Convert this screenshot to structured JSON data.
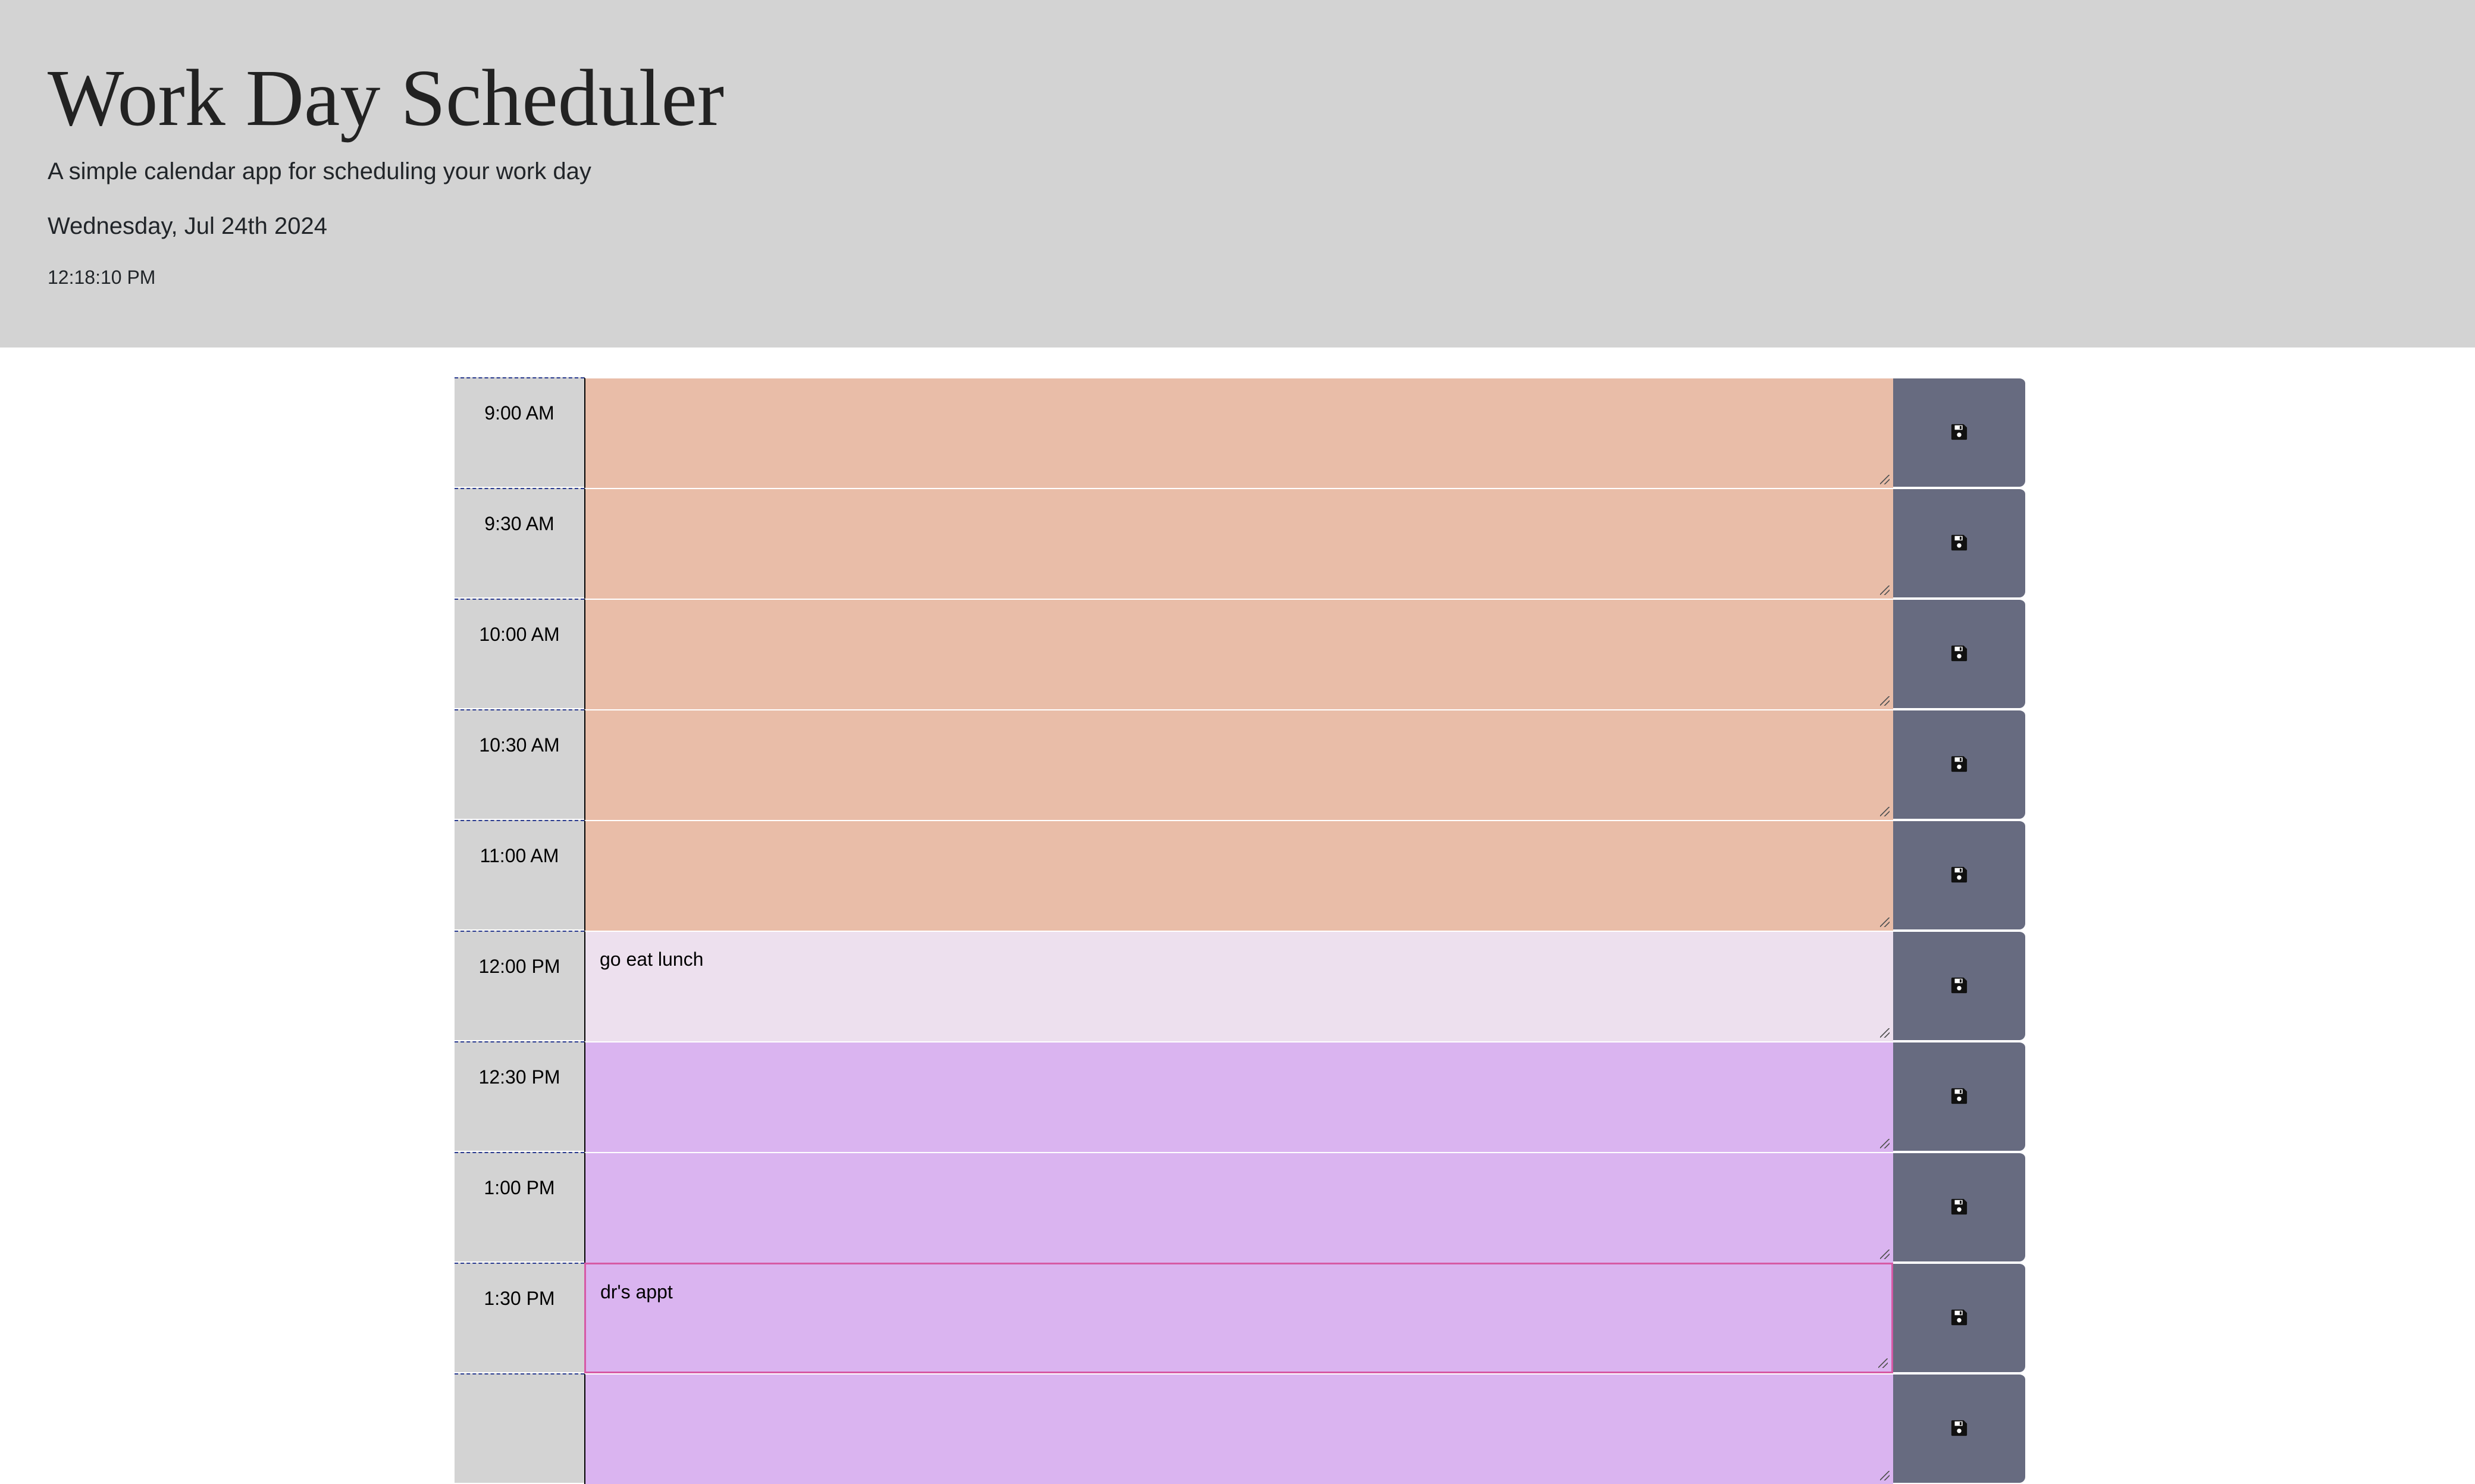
{
  "header": {
    "title": "Work Day Scheduler",
    "subtitle": "A simple calendar app for scheduling your work day",
    "date": "Wednesday, Jul 24th 2024",
    "time": "12:18:10 PM"
  },
  "colors": {
    "past": "#e9bda8",
    "present": "#ede0ee",
    "future": "#dab4f0",
    "save_button": "#676b80",
    "header_bg": "#d3d3d3"
  },
  "icons": {
    "save": "floppy-disk-icon"
  },
  "timeblocks": [
    {
      "hour": "9:00 AM",
      "text": "",
      "state": "past"
    },
    {
      "hour": "9:30 AM",
      "text": "",
      "state": "past"
    },
    {
      "hour": "10:00 AM",
      "text": "",
      "state": "past"
    },
    {
      "hour": "10:30 AM",
      "text": "",
      "state": "past"
    },
    {
      "hour": "11:00 AM",
      "text": "",
      "state": "past"
    },
    {
      "hour": "12:00 PM",
      "text": "go eat lunch",
      "state": "present"
    },
    {
      "hour": "12:30 PM",
      "text": "",
      "state": "future"
    },
    {
      "hour": "1:00 PM",
      "text": "",
      "state": "future"
    },
    {
      "hour": "1:30 PM",
      "text": "dr's appt",
      "state": "future"
    },
    {
      "hour": "",
      "text": "",
      "state": "future"
    }
  ]
}
